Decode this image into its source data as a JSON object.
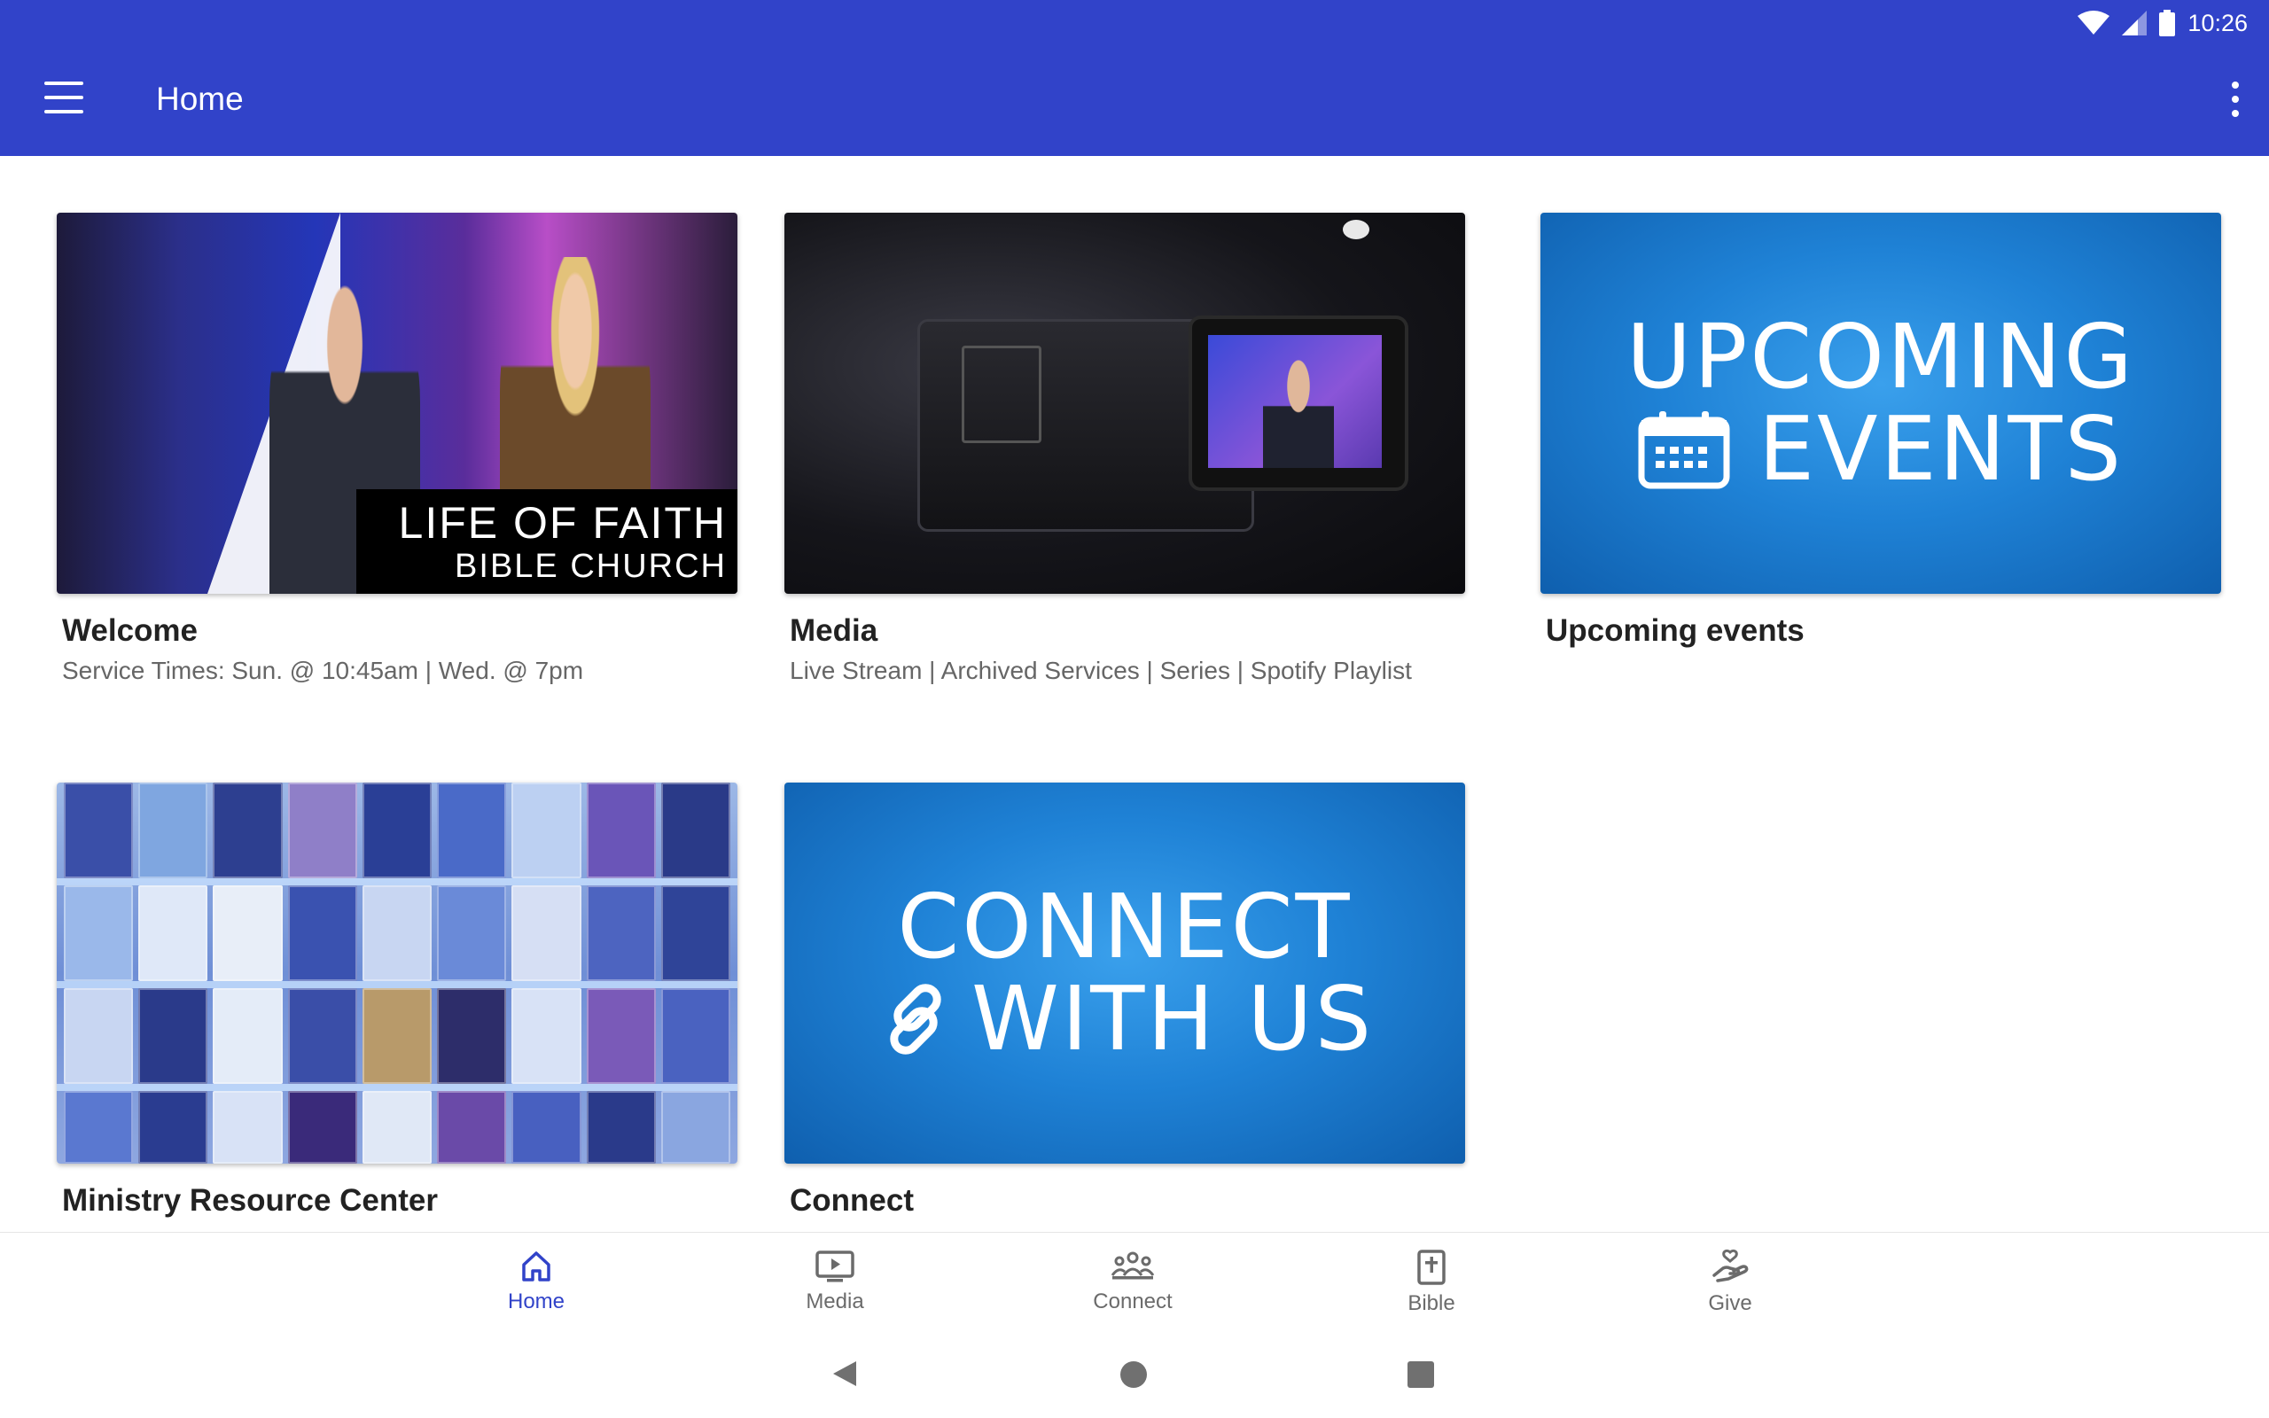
{
  "status_bar": {
    "time": "10:26"
  },
  "app_bar": {
    "title": "Home"
  },
  "cards": [
    {
      "title": "Welcome",
      "subtitle": "Service Times: Sun. @ 10:45am | Wed. @ 7pm",
      "image_text_1": "LIFE OF FAITH",
      "image_text_2": "BIBLE CHURCH"
    },
    {
      "title": "Media",
      "subtitle": "Live Stream | Archived Services | Series | Spotify Playlist"
    },
    {
      "title": "Upcoming events",
      "subtitle": "",
      "image_text_1": "UPCOMING",
      "image_text_2": "EVENTS"
    },
    {
      "title": "Ministry Resource Center",
      "subtitle": ""
    },
    {
      "title": "Connect",
      "subtitle": "",
      "image_text_1": "CONNECT",
      "image_text_2": "WITH US"
    }
  ],
  "bottom_nav": [
    {
      "label": "Home",
      "icon": "home-icon",
      "active": true
    },
    {
      "label": "Media",
      "icon": "tv-play-icon",
      "active": false
    },
    {
      "label": "Connect",
      "icon": "people-icon",
      "active": false
    },
    {
      "label": "Bible",
      "icon": "bible-icon",
      "active": false
    },
    {
      "label": "Give",
      "icon": "give-hand-icon",
      "active": false
    }
  ],
  "colors": {
    "primary": "#3143c9",
    "inactive": "#6b6b6b"
  }
}
